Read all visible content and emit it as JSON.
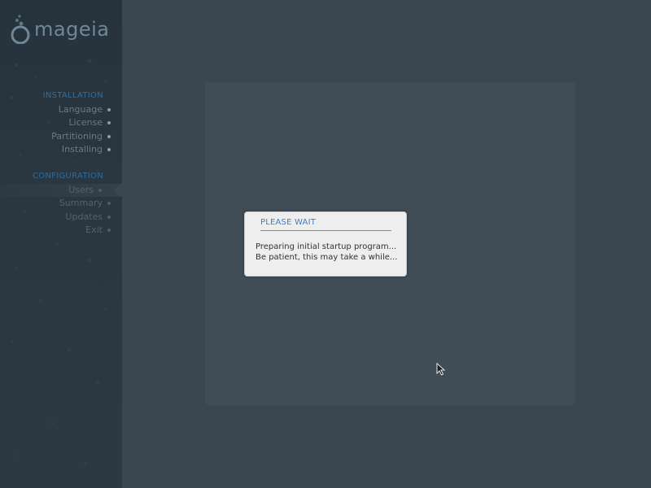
{
  "logo": {
    "text": "mageia"
  },
  "sidebar": {
    "sections": [
      {
        "title": "INSTALLATION",
        "items": [
          {
            "label": "Language",
            "state": "done"
          },
          {
            "label": "License",
            "state": "done"
          },
          {
            "label": "Partitioning",
            "state": "done"
          },
          {
            "label": "Installing",
            "state": "done"
          }
        ]
      },
      {
        "title": "CONFIGURATION",
        "items": [
          {
            "label": "Users",
            "state": "active"
          },
          {
            "label": "Summary",
            "state": "pending"
          },
          {
            "label": "Updates",
            "state": "pending"
          },
          {
            "label": "Exit",
            "state": "pending"
          }
        ]
      }
    ]
  },
  "dialog": {
    "title": "PLEASE WAIT",
    "lines": [
      "Preparing initial startup program...",
      "Be patient, this may take a while..."
    ]
  },
  "colors": {
    "background": "#3a4650",
    "sidebar": "#2a3640",
    "section_title": "#2f6da0",
    "dialog_title": "#3a7ec6",
    "dialog_background": "#eeeeee"
  },
  "icons": {
    "logo": "mageia-cauldron-icon",
    "cursor": "mouse-pointer-icon"
  }
}
